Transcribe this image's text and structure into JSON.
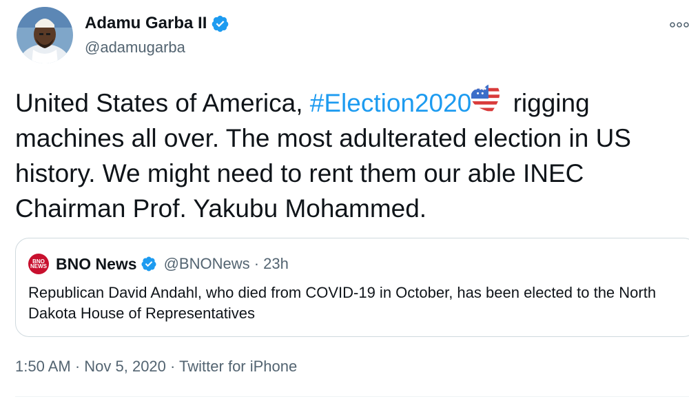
{
  "author": {
    "name": "Adamu Garba II",
    "handle": "@adamugarba",
    "verified": true
  },
  "tweet": {
    "text_before": "United States of America, ",
    "hashtag": "#Election2020",
    "emoji": "us-flag-heart-icon",
    "text_after": " rigging machines all over. The most adulterated election in US history. We might need to rent them our able INEC Chairman Prof. Yakubu Mohammed."
  },
  "quote": {
    "avatar_text": "BNO NEWS",
    "name": "BNO News",
    "handle_time": "@BNONews · 23h",
    "text": "Republican David Andahl, who died from COVID-19 in October, has been elected to the North Dakota House of Representatives"
  },
  "meta": {
    "text": "1:50 AM · Nov 5, 2020 · Twitter for iPhone"
  },
  "colors": {
    "link": "#1d9bf0",
    "secondary_text": "#536471",
    "verified": "#1d9bf0"
  }
}
